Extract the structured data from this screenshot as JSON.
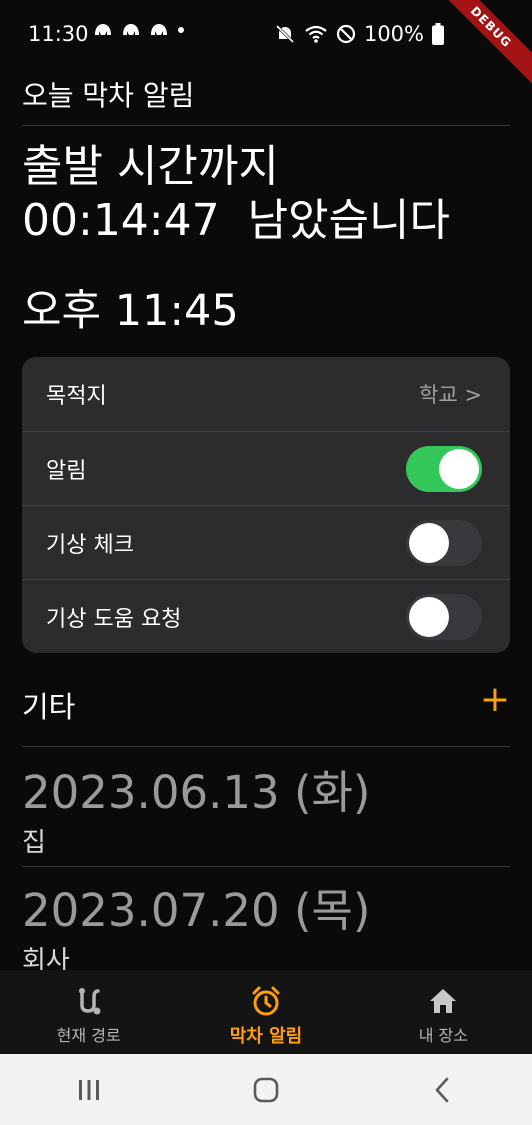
{
  "status_bar": {
    "time": "11:30",
    "battery": "100%",
    "debug_label": "DEBUG"
  },
  "app": {
    "title": "오늘 막차 알림"
  },
  "countdown": {
    "line1": "출발 시간까지",
    "line2": "00:14:47  남았습니다"
  },
  "alarm_time": "오후 11:45",
  "settings": {
    "destination_label": "목적지",
    "destination_value": "학교 >",
    "alarm_label": "알림",
    "alarm_on": true,
    "wake_check_label": "기상 체크",
    "wake_check_on": false,
    "wake_help_label": "기상 도움 요청",
    "wake_help_on": false
  },
  "others": {
    "title": "기타",
    "add_symbol": "+",
    "items": [
      {
        "date": "2023.06.13 (화)",
        "place": "집"
      },
      {
        "date": "2023.07.20 (목)",
        "place": "회사"
      }
    ]
  },
  "bottom_nav": {
    "items": [
      {
        "label": "현재 경로",
        "icon": "route-icon"
      },
      {
        "label": "막차 알림",
        "icon": "alarm-clock-icon"
      },
      {
        "label": "내 장소",
        "icon": "home-icon"
      }
    ],
    "active_index": 1
  },
  "colors": {
    "accent": "#ff9f0a",
    "toggle_on": "#34c759",
    "card_bg": "#2c2c2e",
    "background": "#0a0a0a"
  }
}
